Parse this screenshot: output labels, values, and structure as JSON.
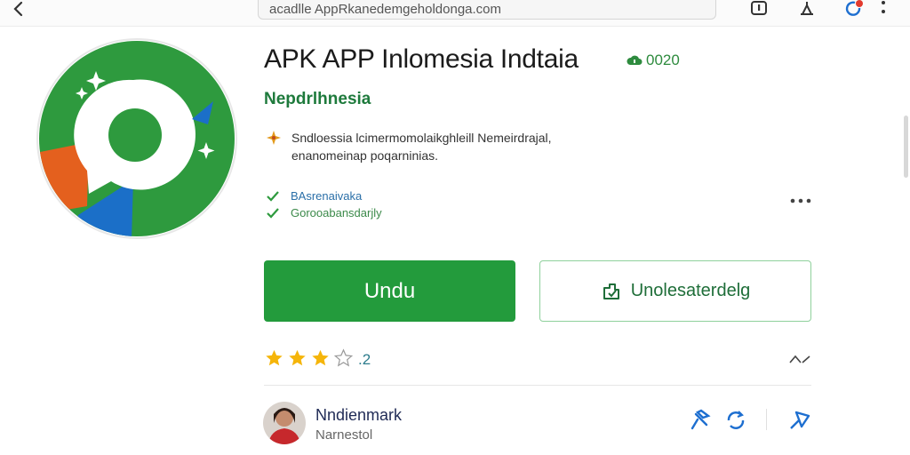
{
  "browser": {
    "url": "acadlle AppRkanedemgeholdonga.com",
    "badge_color": "#e23a2e"
  },
  "app": {
    "title": "APK APP Inlomesia Indtaia",
    "count": "0020",
    "developer": "Nepdrlhnesia",
    "description_line1": "Sndloessia lcimermomolaikghleill Nemeirdrajal,",
    "description_line2": "enanomeinap poqarninias.",
    "features": [
      "BAsrenaivaka",
      "Gorooabansdarjly"
    ],
    "icon": {
      "colors": {
        "green": "#2e9a3e",
        "orange": "#e4601e",
        "blue": "#1b6fc8",
        "white": "#ffffff"
      }
    }
  },
  "actions": {
    "primary_label": "Undu",
    "secondary_label": "Unolesaterdelg",
    "primary_color": "#239b3c"
  },
  "rating": {
    "filled_stars": 3,
    "total_stars": 4,
    "value": ".2",
    "star_color": "#f5b50a"
  },
  "user": {
    "name": "Nndienmark",
    "subtitle": "Narnestol"
  },
  "icons": {
    "back": "chevron-left-icon",
    "tab": "tab-icon",
    "profile": "person-icon",
    "refresh": "refresh-icon",
    "menu": "more-vertical-icon",
    "sparkle": "sparkle-icon",
    "check": "check-icon",
    "more": "more-horizontal-icon",
    "install_alt": "install-icon",
    "chevron_up": "chevron-up-icon",
    "pin": "pin-icon",
    "sync": "sync-icon",
    "share": "share-icon"
  }
}
